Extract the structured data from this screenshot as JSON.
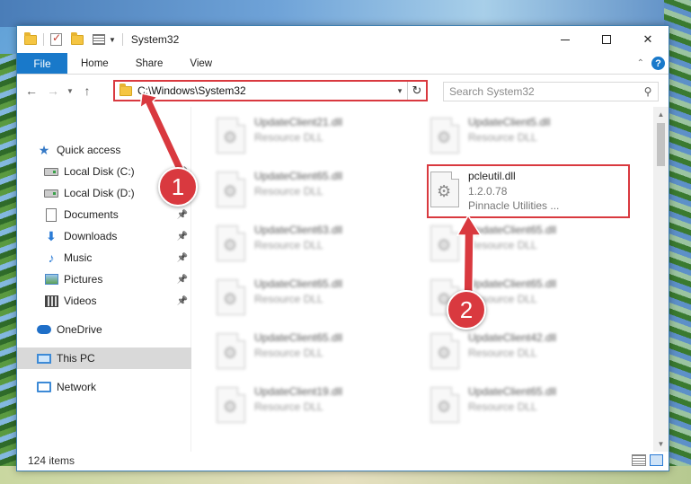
{
  "window": {
    "title": "System32",
    "controls": {
      "minimize": "–",
      "maximize": "□",
      "close": "✕"
    }
  },
  "ribbon": {
    "tabs": [
      "File",
      "Home",
      "Share",
      "View"
    ],
    "help": "?"
  },
  "address": {
    "path": "C:\\Windows\\System32",
    "search_placeholder": "Search System32"
  },
  "nav": {
    "items": [
      {
        "label": "Quick access",
        "icon": "star-icon",
        "pinned": false
      },
      {
        "label": "Local Disk (C:)",
        "icon": "drive-icon",
        "pinned": true
      },
      {
        "label": "Local Disk (D:)",
        "icon": "drive-icon",
        "pinned": true
      },
      {
        "label": "Documents",
        "icon": "documents-icon",
        "pinned": true
      },
      {
        "label": "Downloads",
        "icon": "download-icon",
        "pinned": true
      },
      {
        "label": "Music",
        "icon": "music-icon",
        "pinned": true
      },
      {
        "label": "Pictures",
        "icon": "pictures-icon",
        "pinned": true
      },
      {
        "label": "Videos",
        "icon": "videos-icon",
        "pinned": true
      },
      {
        "label": "OneDrive",
        "icon": "onedrive-icon",
        "pinned": false
      },
      {
        "label": "This PC",
        "icon": "this-pc-icon",
        "pinned": false,
        "selected": true
      },
      {
        "label": "Network",
        "icon": "network-icon",
        "pinned": false
      }
    ]
  },
  "files": [
    {
      "name": "UpdateClient21.dll",
      "sub": "Resource DLL",
      "blurred": true
    },
    {
      "name": "UpdateClient5.dll",
      "sub": "Resource DLL",
      "blurred": true
    },
    {
      "name": "UpdateClient65.dll",
      "sub": "Resource DLL",
      "blurred": true
    },
    {
      "name": "pcleutil.dll",
      "sub": "1.2.0.78",
      "sub2": "Pinnacle Utilities ...",
      "blurred": false,
      "highlighted": true
    },
    {
      "name": "UpdateClient63.dll",
      "sub": "Resource DLL",
      "blurred": true
    },
    {
      "name": "UpdateClient65.dll",
      "sub": "Resource DLL",
      "blurred": true
    },
    {
      "name": "UpdateClient65.dll",
      "sub": "Resource DLL",
      "blurred": true
    },
    {
      "name": "UpdateClient65.dll",
      "sub": "Resource DLL",
      "blurred": true
    },
    {
      "name": "UpdateClient65.dll",
      "sub": "Resource DLL",
      "blurred": true
    },
    {
      "name": "UpdateClient42.dll",
      "sub": "Resource DLL",
      "blurred": true
    },
    {
      "name": "UpdateClient19.dll",
      "sub": "Resource DLL",
      "blurred": true
    },
    {
      "name": "UpdateClient65.dll",
      "sub": "Resource DLL",
      "blurred": true
    }
  ],
  "status": {
    "items_count": "124 items"
  },
  "callouts": [
    "1",
    "2"
  ],
  "colors": {
    "accent": "#1979ca",
    "highlight": "#d9393f"
  }
}
